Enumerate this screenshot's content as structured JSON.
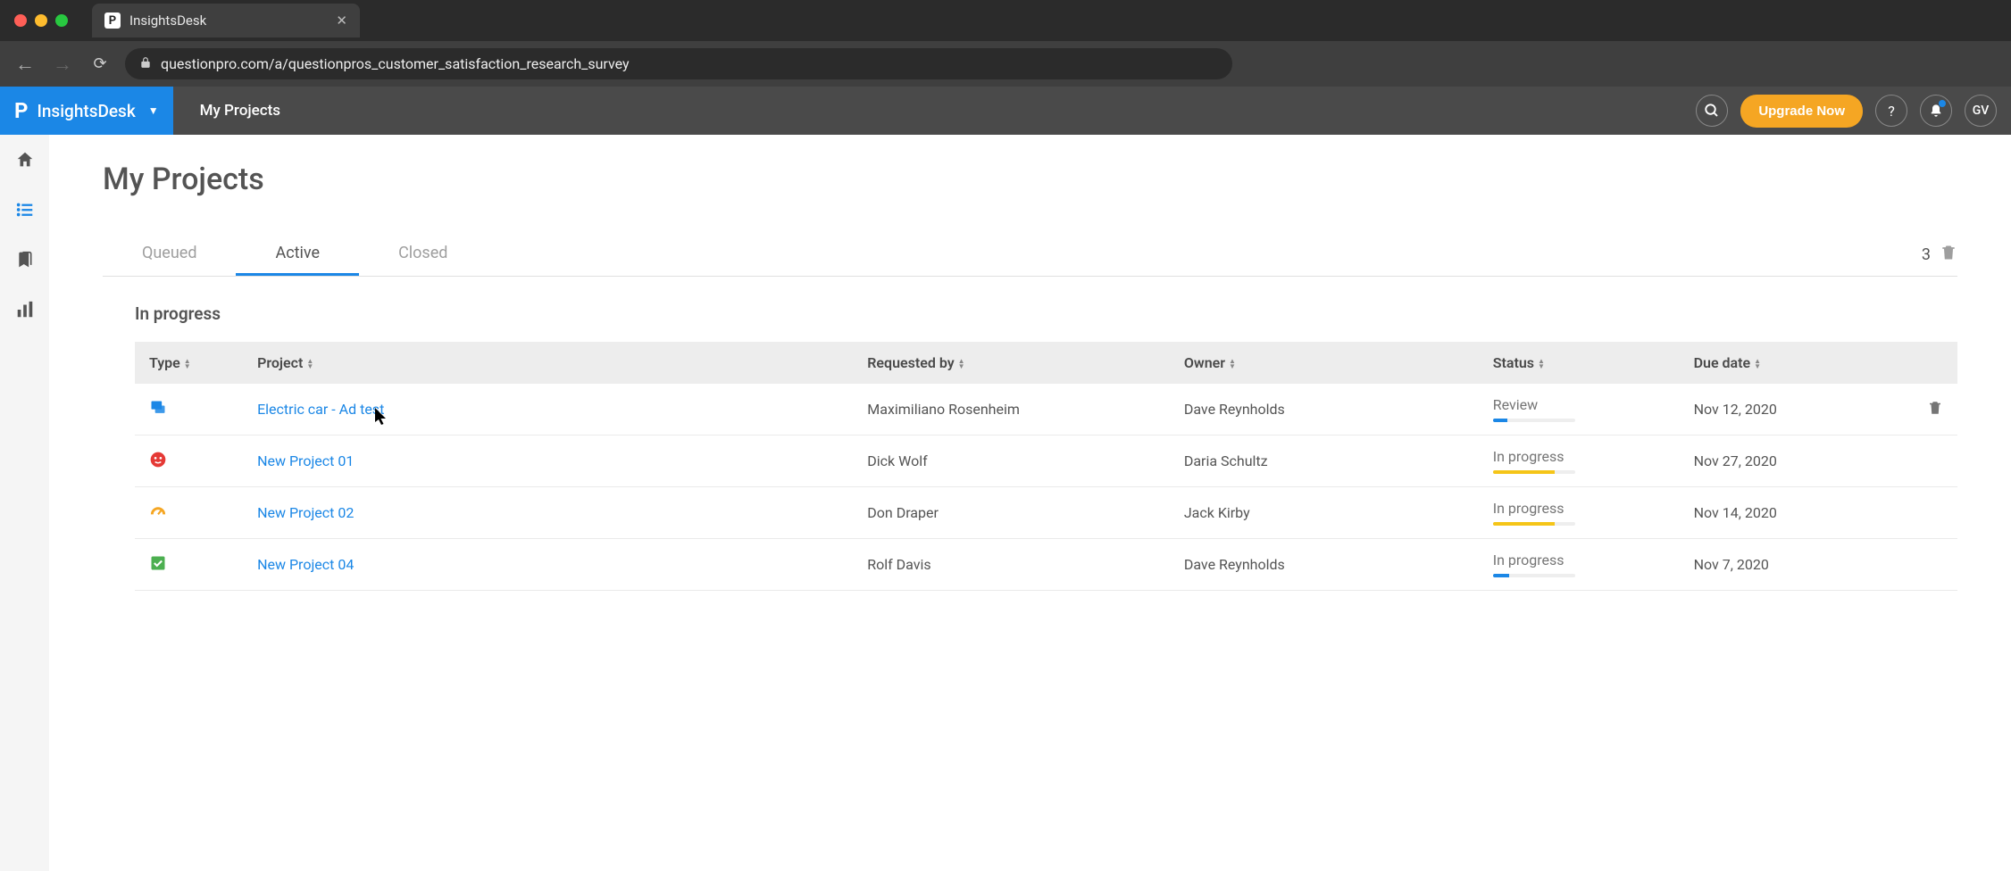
{
  "browser": {
    "tab_title": "InsightsDesk",
    "url": "questionpro.com/a/questionpros_customer_satisfaction_research_survey"
  },
  "header": {
    "brand": "InsightsDesk",
    "section": "My Projects",
    "upgrade_label": "Upgrade Now",
    "avatar_initials": "GV"
  },
  "page": {
    "title": "My Projects",
    "tabs": {
      "queued": "Queued",
      "active": "Active",
      "closed": "Closed"
    },
    "count": "3",
    "section_heading": "In progress"
  },
  "columns": {
    "type": "Type",
    "project": "Project",
    "requested_by": "Requested by",
    "owner": "Owner",
    "status": "Status",
    "due_date": "Due date"
  },
  "rows": [
    {
      "type_icon": "chat",
      "type_color": "#1b87e6",
      "project": "Electric car - Ad test",
      "requested_by": "Maximiliano Rosenheim",
      "owner": "Dave Reynholds",
      "status": "Review",
      "progress_pct": 18,
      "progress_color": "#1b87e6",
      "due_date": "Nov 12, 2020",
      "show_delete": true
    },
    {
      "type_icon": "face",
      "type_color": "#e53935",
      "project": "New Project 01",
      "requested_by": "Dick Wolf",
      "owner": "Daria Schultz",
      "status": "In progress",
      "progress_pct": 75,
      "progress_color": "#f5c518",
      "due_date": "Nov 27, 2020",
      "show_delete": false
    },
    {
      "type_icon": "speed",
      "type_color": "#f5a623",
      "project": "New Project 02",
      "requested_by": "Don Draper",
      "owner": "Jack Kirby",
      "status": "In progress",
      "progress_pct": 75,
      "progress_color": "#f5c518",
      "due_date": "Nov 14, 2020",
      "show_delete": false
    },
    {
      "type_icon": "check",
      "type_color": "#4caf50",
      "project": "New Project 04",
      "requested_by": "Rolf Davis",
      "owner": "Dave Reynholds",
      "status": "In progress",
      "progress_pct": 20,
      "progress_color": "#1b87e6",
      "due_date": "Nov 7, 2020",
      "show_delete": false
    }
  ]
}
